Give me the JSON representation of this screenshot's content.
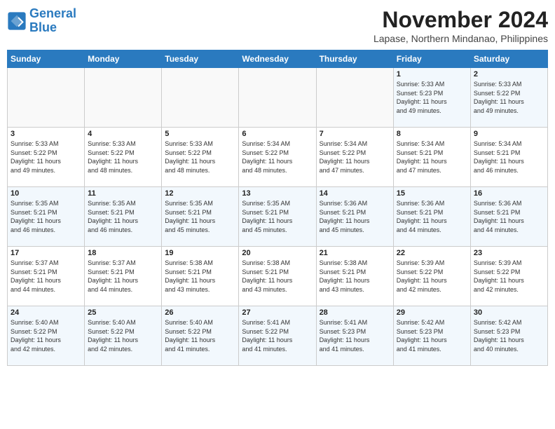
{
  "header": {
    "logo_line1": "General",
    "logo_line2": "Blue",
    "month": "November 2024",
    "location": "Lapase, Northern Mindanao, Philippines"
  },
  "weekdays": [
    "Sunday",
    "Monday",
    "Tuesday",
    "Wednesday",
    "Thursday",
    "Friday",
    "Saturday"
  ],
  "weeks": [
    [
      {
        "day": "",
        "info": ""
      },
      {
        "day": "",
        "info": ""
      },
      {
        "day": "",
        "info": ""
      },
      {
        "day": "",
        "info": ""
      },
      {
        "day": "",
        "info": ""
      },
      {
        "day": "1",
        "info": "Sunrise: 5:33 AM\nSunset: 5:23 PM\nDaylight: 11 hours\nand 49 minutes."
      },
      {
        "day": "2",
        "info": "Sunrise: 5:33 AM\nSunset: 5:22 PM\nDaylight: 11 hours\nand 49 minutes."
      }
    ],
    [
      {
        "day": "3",
        "info": "Sunrise: 5:33 AM\nSunset: 5:22 PM\nDaylight: 11 hours\nand 49 minutes."
      },
      {
        "day": "4",
        "info": "Sunrise: 5:33 AM\nSunset: 5:22 PM\nDaylight: 11 hours\nand 48 minutes."
      },
      {
        "day": "5",
        "info": "Sunrise: 5:33 AM\nSunset: 5:22 PM\nDaylight: 11 hours\nand 48 minutes."
      },
      {
        "day": "6",
        "info": "Sunrise: 5:34 AM\nSunset: 5:22 PM\nDaylight: 11 hours\nand 48 minutes."
      },
      {
        "day": "7",
        "info": "Sunrise: 5:34 AM\nSunset: 5:22 PM\nDaylight: 11 hours\nand 47 minutes."
      },
      {
        "day": "8",
        "info": "Sunrise: 5:34 AM\nSunset: 5:21 PM\nDaylight: 11 hours\nand 47 minutes."
      },
      {
        "day": "9",
        "info": "Sunrise: 5:34 AM\nSunset: 5:21 PM\nDaylight: 11 hours\nand 46 minutes."
      }
    ],
    [
      {
        "day": "10",
        "info": "Sunrise: 5:35 AM\nSunset: 5:21 PM\nDaylight: 11 hours\nand 46 minutes."
      },
      {
        "day": "11",
        "info": "Sunrise: 5:35 AM\nSunset: 5:21 PM\nDaylight: 11 hours\nand 46 minutes."
      },
      {
        "day": "12",
        "info": "Sunrise: 5:35 AM\nSunset: 5:21 PM\nDaylight: 11 hours\nand 45 minutes."
      },
      {
        "day": "13",
        "info": "Sunrise: 5:35 AM\nSunset: 5:21 PM\nDaylight: 11 hours\nand 45 minutes."
      },
      {
        "day": "14",
        "info": "Sunrise: 5:36 AM\nSunset: 5:21 PM\nDaylight: 11 hours\nand 45 minutes."
      },
      {
        "day": "15",
        "info": "Sunrise: 5:36 AM\nSunset: 5:21 PM\nDaylight: 11 hours\nand 44 minutes."
      },
      {
        "day": "16",
        "info": "Sunrise: 5:36 AM\nSunset: 5:21 PM\nDaylight: 11 hours\nand 44 minutes."
      }
    ],
    [
      {
        "day": "17",
        "info": "Sunrise: 5:37 AM\nSunset: 5:21 PM\nDaylight: 11 hours\nand 44 minutes."
      },
      {
        "day": "18",
        "info": "Sunrise: 5:37 AM\nSunset: 5:21 PM\nDaylight: 11 hours\nand 44 minutes."
      },
      {
        "day": "19",
        "info": "Sunrise: 5:38 AM\nSunset: 5:21 PM\nDaylight: 11 hours\nand 43 minutes."
      },
      {
        "day": "20",
        "info": "Sunrise: 5:38 AM\nSunset: 5:21 PM\nDaylight: 11 hours\nand 43 minutes."
      },
      {
        "day": "21",
        "info": "Sunrise: 5:38 AM\nSunset: 5:21 PM\nDaylight: 11 hours\nand 43 minutes."
      },
      {
        "day": "22",
        "info": "Sunrise: 5:39 AM\nSunset: 5:22 PM\nDaylight: 11 hours\nand 42 minutes."
      },
      {
        "day": "23",
        "info": "Sunrise: 5:39 AM\nSunset: 5:22 PM\nDaylight: 11 hours\nand 42 minutes."
      }
    ],
    [
      {
        "day": "24",
        "info": "Sunrise: 5:40 AM\nSunset: 5:22 PM\nDaylight: 11 hours\nand 42 minutes."
      },
      {
        "day": "25",
        "info": "Sunrise: 5:40 AM\nSunset: 5:22 PM\nDaylight: 11 hours\nand 42 minutes."
      },
      {
        "day": "26",
        "info": "Sunrise: 5:40 AM\nSunset: 5:22 PM\nDaylight: 11 hours\nand 41 minutes."
      },
      {
        "day": "27",
        "info": "Sunrise: 5:41 AM\nSunset: 5:22 PM\nDaylight: 11 hours\nand 41 minutes."
      },
      {
        "day": "28",
        "info": "Sunrise: 5:41 AM\nSunset: 5:23 PM\nDaylight: 11 hours\nand 41 minutes."
      },
      {
        "day": "29",
        "info": "Sunrise: 5:42 AM\nSunset: 5:23 PM\nDaylight: 11 hours\nand 41 minutes."
      },
      {
        "day": "30",
        "info": "Sunrise: 5:42 AM\nSunset: 5:23 PM\nDaylight: 11 hours\nand 40 minutes."
      }
    ]
  ]
}
